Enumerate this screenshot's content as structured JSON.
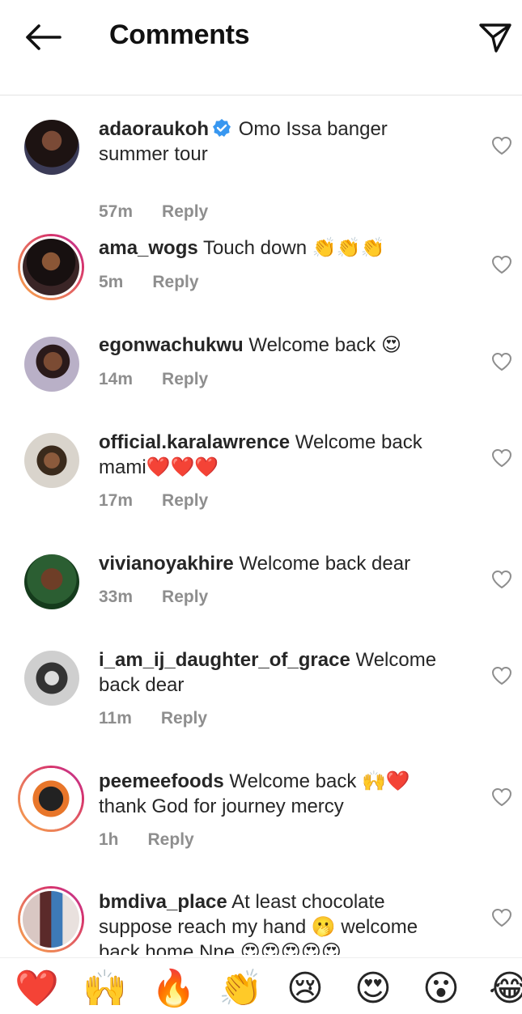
{
  "header": {
    "title": "Comments"
  },
  "comments": [
    {
      "user": "adaoraukoh",
      "text": "Omo Issa banger summer tour",
      "time": "57m",
      "reply": "Reply",
      "verified": true
    },
    {
      "user": "ama_wogs",
      "text": "Touch down 👏👏👏",
      "time": "5m",
      "reply": "Reply"
    },
    {
      "user": "egonwachukwu",
      "text": "Welcome back 😍",
      "time": "14m",
      "reply": "Reply"
    },
    {
      "user": "official.karalawrence",
      "text": "Welcome back mami❤️❤️❤️",
      "time": "17m",
      "reply": "Reply"
    },
    {
      "user": "vivianoyakhire",
      "text": "Welcome back dear",
      "time": "33m",
      "reply": "Reply"
    },
    {
      "user": "i_am_ij_daughter_of_grace",
      "text": "Welcome back dear",
      "time": "11m",
      "reply": "Reply"
    },
    {
      "user": "peemeefoods",
      "text": "Welcome back 🙌❤️ thank God for journey mercy",
      "time": "1h",
      "reply": "Reply"
    },
    {
      "user": "bmdiva_place",
      "text": "At least chocolate suppose reach my hand 🫢 welcome back home Nne 😍😍😍😍😍"
    }
  ],
  "reaction_bar": [
    "❤️",
    "🙌",
    "🔥",
    "👏",
    "😢",
    "😍",
    "😮",
    "😂"
  ],
  "colors": {
    "text": "#262626",
    "meta": "#8e8e8e",
    "verified": "#3897f0",
    "divider": "#e3e3e3"
  },
  "icons": {
    "back": "arrow-left-icon",
    "send": "paper-plane-icon",
    "like": "heart-outline-icon",
    "verified": "verified-badge-icon"
  }
}
